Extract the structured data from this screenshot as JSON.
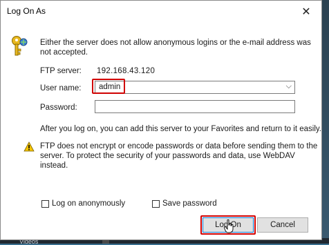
{
  "dialog": {
    "title": "Log On As",
    "close_glyph": "✕",
    "message": "Either the server does not allow anonymous logins or the e-mail address was not accepted.",
    "ftp_server_label": "FTP server:",
    "ftp_server_value": "192.168.43.120",
    "user_name_label": "User name:",
    "user_name_value": "admin",
    "password_label": "Password:",
    "password_value": "",
    "after_logon_text": "After you log on, you can add this server to your Favorites and return to it easily.",
    "warning_text": "FTP does not encrypt or encode passwords or data before sending them to the server.  To protect the security of your passwords and data, use WebDAV instead.",
    "log_on_anonymously_label": "Log on anonymously",
    "log_on_anonymously_checked": false,
    "save_password_label": "Save password",
    "save_password_checked": false,
    "logon_button_label": "Log On",
    "cancel_button_label": "Cancel"
  },
  "background": {
    "bottom_text": "Videos"
  },
  "colors": {
    "highlight": "#d00000",
    "focus_border": "#0078d7",
    "warning": "#f5c400"
  }
}
